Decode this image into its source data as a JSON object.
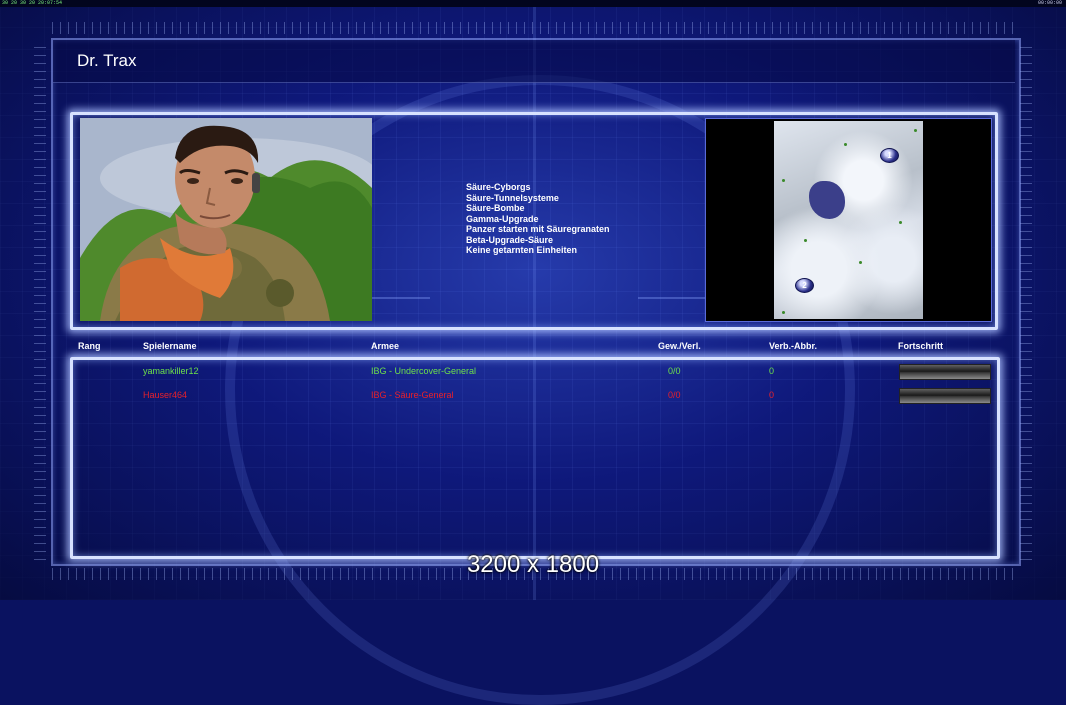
{
  "topbar": {
    "left_text": "30 20 30 20 20:07:54",
    "right_text": "00:00:00"
  },
  "title": "Dr. Trax",
  "rules": [
    "Säure-Cyborgs",
    "Säure-Tunnelsysteme",
    "Säure-Bombe",
    "Gamma-Upgrade",
    "Panzer starten mit Säuregranaten",
    "Beta-Upgrade-Säure",
    "Keine getarnten Einheiten"
  ],
  "map": {
    "markers": [
      "1",
      "2"
    ]
  },
  "table": {
    "headers": {
      "rank": "Rang",
      "player": "Spielername",
      "army": "Armee",
      "winloss": "Gew./Verl.",
      "disconnects": "Verb.-Abbr.",
      "progress": "Fortschritt"
    },
    "rows": [
      {
        "rank": "",
        "player": "yamankiller12",
        "army": "IBG - Undercover-General",
        "winloss": "0/0",
        "disconnects": "0",
        "progress": 0,
        "color": "#6ee04a"
      },
      {
        "rank": "",
        "player": "Hauser464",
        "army": "IBG - Säure-General",
        "winloss": "0/0",
        "disconnects": "0",
        "progress": 0,
        "color": "#e8202a"
      }
    ]
  },
  "resolution_label": "3200 x 1800",
  "colors": {
    "background": "#0b1570",
    "panel_glow": "#d8e2ff",
    "player1": "#6ee04a",
    "player2": "#e8202a"
  },
  "icons": [
    "portrait-image",
    "minimap-image",
    "start-position-marker"
  ]
}
